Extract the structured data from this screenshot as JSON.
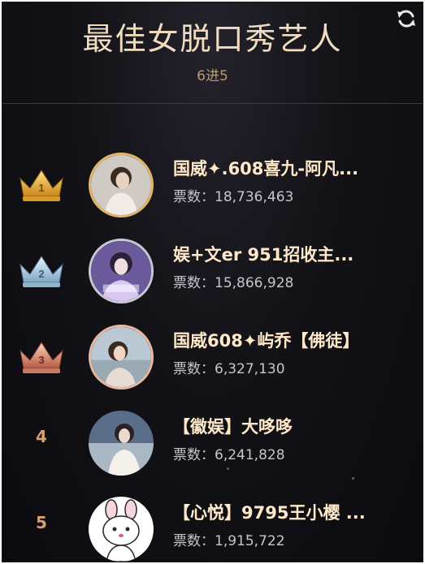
{
  "header": {
    "title": "最佳女脱口秀艺人",
    "subtitle": "6进5",
    "refresh_icon": "refresh-icon"
  },
  "votes_label": "票数：",
  "entries": [
    {
      "rank": "1",
      "badge": "gold-crown-icon",
      "name": "国威✦.608喜九-阿凡...",
      "votes": "18,736,463"
    },
    {
      "rank": "2",
      "badge": "silver-crown-icon",
      "name": "娱+文er 951招收主...",
      "votes": "15,866,928"
    },
    {
      "rank": "3",
      "badge": "bronze-crown-icon",
      "name": "国威608✦屿乔【佛徒】",
      "votes": "6,327,130"
    },
    {
      "rank": "4",
      "badge": "",
      "name": "【徽娱】大哆哆",
      "votes": "6,241,828"
    },
    {
      "rank": "5",
      "badge": "",
      "name": "【心悦】9795王小樱 ...",
      "votes": "1,915,722"
    }
  ],
  "colors": {
    "background": "#0b0b0f",
    "title": "#f0dcc0",
    "name": "#ffe9c8",
    "gold": "#e3a93a",
    "silver": "#9ec6e2",
    "bronze": "#d9826a"
  }
}
